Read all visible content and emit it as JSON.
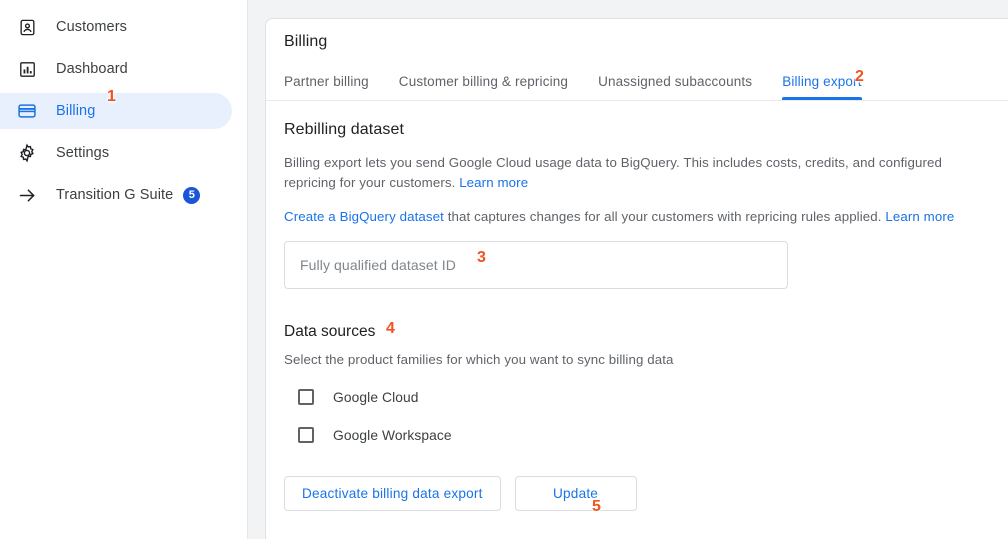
{
  "sidebar": {
    "items": [
      {
        "label": "Customers",
        "icon": "contact-card-icon",
        "active": false,
        "badge": null
      },
      {
        "label": "Dashboard",
        "icon": "bar-chart-icon",
        "active": false,
        "badge": null
      },
      {
        "label": "Billing",
        "icon": "credit-card-icon",
        "active": true,
        "badge": null
      },
      {
        "label": "Settings",
        "icon": "gear-icon",
        "active": false,
        "badge": null
      },
      {
        "label": "Transition G Suite",
        "icon": "arrow-right-icon",
        "active": false,
        "badge": "5"
      }
    ]
  },
  "header": {
    "title": "Billing",
    "tabs": [
      {
        "label": "Partner billing",
        "active": false
      },
      {
        "label": "Customer billing & repricing",
        "active": false
      },
      {
        "label": "Unassigned subaccounts",
        "active": false
      },
      {
        "label": "Billing export",
        "active": true
      }
    ]
  },
  "main": {
    "section_title": "Rebilling dataset",
    "paragraph1_text": "Billing export lets you send Google Cloud usage data to BigQuery. This includes costs, credits, and configured repricing for your customers. ",
    "paragraph1_link": "Learn more",
    "paragraph2_link_start": "Create a BigQuery dataset",
    "paragraph2_text": " that captures changes for all your customers with repricing rules applied. ",
    "paragraph2_link_end": "Learn more",
    "dataset_input": {
      "value": "",
      "placeholder": "Fully qualified dataset ID"
    },
    "data_sources": {
      "title": "Data sources",
      "subtitle": "Select the product families for which you want to sync billing data",
      "options": [
        {
          "label": "Google Cloud",
          "checked": false
        },
        {
          "label": "Google Workspace",
          "checked": false
        }
      ]
    },
    "buttons": {
      "deactivate_label": "Deactivate billing data export",
      "update_label": "Update"
    }
  },
  "annotations": [
    {
      "number": "1",
      "target": "sidebar-item-billing"
    },
    {
      "number": "2",
      "target": "tab-billing-export"
    },
    {
      "number": "3",
      "target": "dataset-id-input"
    },
    {
      "number": "4",
      "target": "data-sources-title"
    },
    {
      "number": "5",
      "target": "update-button"
    }
  ],
  "colors": {
    "accent": "#1a73e8",
    "active_pill": "#e8f0fe",
    "badge": "#1a56d6",
    "annotation": "#f4511e",
    "text_primary": "#202124",
    "text_secondary": "#5f6368",
    "gutter": "#f1f3f4"
  }
}
